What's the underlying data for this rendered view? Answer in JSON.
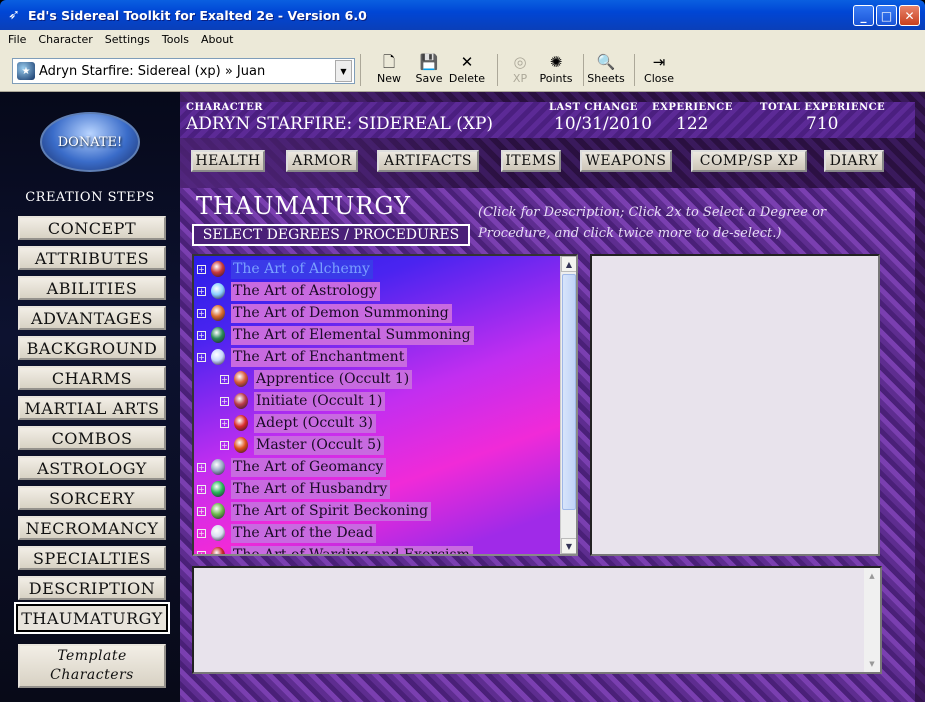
{
  "window": {
    "title": "Ed's Sidereal Toolkit for Exalted 2e - Version 6.0",
    "minimize": "_",
    "maximize": "□",
    "close": "✕"
  },
  "menu": [
    "File",
    "Character",
    "Settings",
    "Tools",
    "About"
  ],
  "toolbar": {
    "character_select": "Adryn Starfire: Sidereal (xp) » Juan",
    "buttons": [
      {
        "label": "New",
        "icon": "new-document-icon",
        "glyph": "🗋",
        "enabled": true
      },
      {
        "label": "Save",
        "icon": "floppy-disk-icon",
        "glyph": "💾",
        "enabled": true
      },
      {
        "label": "Delete",
        "icon": "delete-x-icon",
        "glyph": "✕",
        "enabled": true
      },
      {
        "label": "XP",
        "icon": "xp-icon",
        "glyph": "◎",
        "enabled": false
      },
      {
        "label": "Points",
        "icon": "points-icon",
        "glyph": "✺",
        "enabled": true
      },
      {
        "label": "Sheets",
        "icon": "sheets-preview-icon",
        "glyph": "🔍",
        "enabled": true
      },
      {
        "label": "Close",
        "icon": "close-door-icon",
        "glyph": "⇥",
        "enabled": true
      }
    ]
  },
  "sidebar": {
    "donate_label": "DONATE!",
    "creation_steps_title": "CREATION STEPS",
    "steps": [
      "CONCEPT",
      "ATTRIBUTES",
      "ABILITIES",
      "ADVANTAGES",
      "BACKGROUND",
      "CHARMS",
      "MARTIAL ARTS",
      "COMBOS",
      "ASTROLOGY",
      "SORCERY",
      "NECROMANCY",
      "SPECIALTIES",
      "DESCRIPTION",
      "THAUMATURGY"
    ],
    "active_step": "THAUMATURGY",
    "template_line1": "Template",
    "template_line2": "Characters"
  },
  "header": {
    "character_label": "CHARACTER",
    "character_value": "ADRYN STARFIRE: SIDEREAL (XP)",
    "last_change_label": "LAST CHANGE",
    "last_change_value": "10/31/2010",
    "experience_label": "EXPERIENCE",
    "experience_value": "122",
    "total_experience_label": "TOTAL EXPERIENCE",
    "total_experience_value": "710"
  },
  "tabs": [
    "HEALTH",
    "ARMOR",
    "ARTIFACTS",
    "ITEMS",
    "WEAPONS",
    "COMP/SP XP",
    "DIARY"
  ],
  "thaumaturgy": {
    "title": "THAUMATURGY",
    "select_button": "SELECT DEGREES / PROCEDURES",
    "hint": "(Click for Description;  Click 2x to Select a Degree or Procedure, and click twice more to de-select.)",
    "tree": [
      {
        "label": "The Art of Alchemy",
        "level": 0,
        "selected": true,
        "icon_color": "#c83a3a"
      },
      {
        "label": "The Art of Astrology",
        "level": 0,
        "selected": false,
        "icon_color": "#8ad0ff"
      },
      {
        "label": "The Art of Demon Summoning",
        "level": 0,
        "selected": false,
        "icon_color": "#d86a2a"
      },
      {
        "label": "The Art of Elemental Summoning",
        "level": 0,
        "selected": false,
        "icon_color": "#2a8a5a"
      },
      {
        "label": "The Art of Enchantment",
        "level": 0,
        "selected": false,
        "icon_color": "#c8d8ff"
      },
      {
        "label": "Apprentice (Occult 1)",
        "level": 1,
        "selected": false,
        "icon_color": "#d85a3a"
      },
      {
        "label": "Initiate (Occult 1)",
        "level": 1,
        "selected": false,
        "icon_color": "#b83a4a"
      },
      {
        "label": "Adept (Occult 3)",
        "level": 1,
        "selected": false,
        "icon_color": "#d82a2a"
      },
      {
        "label": "Master (Occult 5)",
        "level": 1,
        "selected": false,
        "icon_color": "#e0501a"
      },
      {
        "label": "The Art of Geomancy",
        "level": 0,
        "selected": false,
        "icon_color": "#9aa8c8"
      },
      {
        "label": "The Art of Husbandry",
        "level": 0,
        "selected": false,
        "icon_color": "#2ab85a"
      },
      {
        "label": "The Art of Spirit Beckoning",
        "level": 0,
        "selected": false,
        "icon_color": "#6ab84a"
      },
      {
        "label": "The Art of the Dead",
        "level": 0,
        "selected": false,
        "icon_color": "#d8e0f0"
      },
      {
        "label": "The Art of Warding and Exorcism",
        "level": 0,
        "selected": false,
        "icon_color": "#c82a2a"
      }
    ]
  }
}
